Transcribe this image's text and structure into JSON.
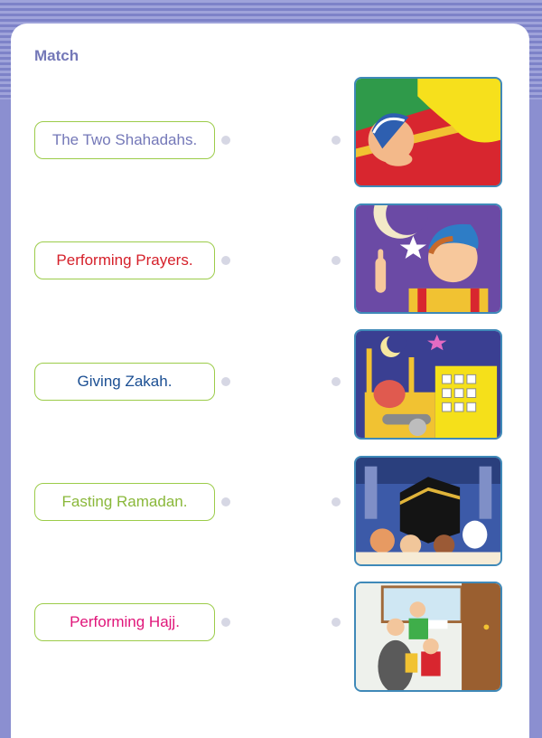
{
  "title": "Match",
  "items": [
    {
      "label": "The Two Shahadahs.",
      "color": "#7478b8"
    },
    {
      "label": "Performing Prayers.",
      "color": "#d5202a"
    },
    {
      "label": "Giving Zakah.",
      "color": "#1b4f93"
    },
    {
      "label": "Fasting Ramadan.",
      "color": "#8ab83a"
    },
    {
      "label": "Performing Hajj.",
      "color": "#e0167a"
    }
  ],
  "pictures": [
    {
      "icon": "prayer-prostration-illustration"
    },
    {
      "icon": "boy-pointing-at-sky-illustration"
    },
    {
      "icon": "ramadan-cannon-night-illustration"
    },
    {
      "icon": "kaaba-pilgrims-illustration"
    },
    {
      "icon": "charity-giving-illustration"
    }
  ]
}
